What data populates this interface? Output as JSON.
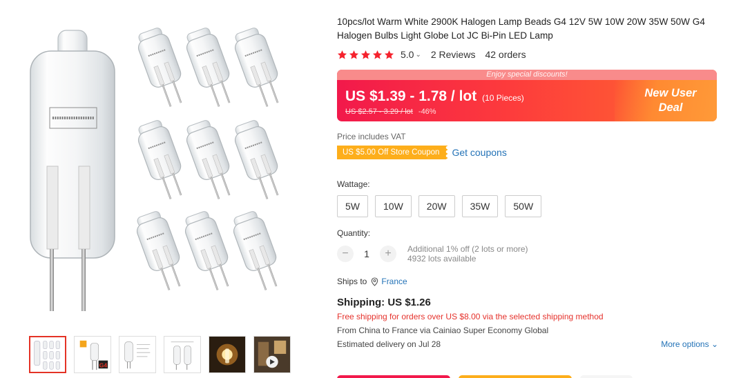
{
  "product": {
    "title": "10pcs/lot Warm White 2900K Halogen Lamp Beads G4 12V 5W 10W 20W 35W 50W G4 Halogen Bulbs Light Globe Lot JC Bi-Pin LED Lamp",
    "rating": "5.0",
    "star_count": 5,
    "reviews": "2 Reviews",
    "orders": "42 orders"
  },
  "gallery": {
    "thumbnails": [
      {
        "name": "thumb-10pcs"
      },
      {
        "name": "thumb-g4-label",
        "caption": "G4"
      },
      {
        "name": "thumb-spec"
      },
      {
        "name": "thumb-high-temp"
      },
      {
        "name": "thumb-lit-bulb"
      },
      {
        "name": "thumb-in-use"
      }
    ]
  },
  "price": {
    "banner": "Enjoy special discounts!",
    "current": "US $1.39 - 1.78 / lot",
    "pieces": "(10 Pieces)",
    "original": "US $2.57 - 3.29 / lot",
    "discount": "-46%",
    "new_user_line1": "New User",
    "new_user_line2": "Deal",
    "vat": "Price includes VAT"
  },
  "coupon": {
    "label": "US $5.00 Off Store Coupon",
    "get": "Get coupons"
  },
  "wattage": {
    "label": "Wattage:",
    "options": [
      "5W",
      "10W",
      "20W",
      "35W",
      "50W"
    ]
  },
  "quantity": {
    "label": "Quantity:",
    "minus": "−",
    "plus": "+",
    "value": "1",
    "note": "Additional 1% off (2 lots or more)",
    "available": "4932 lots available"
  },
  "shipping": {
    "ships_to_label": "Ships to",
    "country": "France",
    "title": "Shipping: US $1.26",
    "free": "Free shipping for orders over US $8.00 via the selected shipping method",
    "from": "From China to France via Cainiao Super Economy Global",
    "delivery": "Estimated delivery on Jul 28",
    "more_options": "More options"
  },
  "colors": {
    "star": "#f5222d",
    "price_start": "#f2194b",
    "price_end": "#ff6a2f",
    "coupon": "#fdae1b",
    "link": "#2473b7",
    "free_ship": "#e5312b"
  }
}
